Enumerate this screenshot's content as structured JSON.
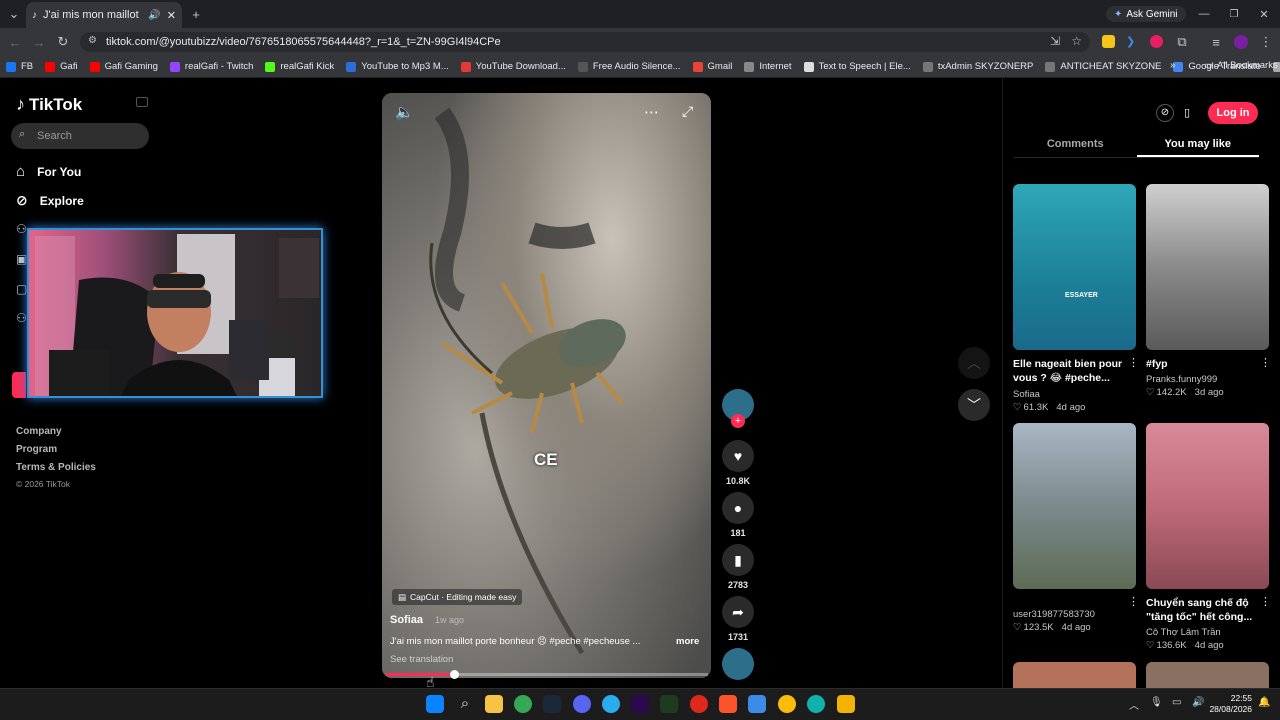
{
  "browser": {
    "tab_title": "J'ai mis mon maillot porte b",
    "url": "tiktok.com/@youtubizz/video/7676518065575644448?_r=1&_t=ZN-99GI4l94CPe",
    "ask_gemini": "Ask Gemini",
    "bookmarks": [
      {
        "label": "FB",
        "color": "#1877f2"
      },
      {
        "label": "Gafi",
        "color": "#ff0000"
      },
      {
        "label": "Gafi Gaming",
        "color": "#ff0000"
      },
      {
        "label": "realGafi - Twitch",
        "color": "#9146ff"
      },
      {
        "label": "realGafi Kick",
        "color": "#53fc18"
      },
      {
        "label": "YouTube to Mp3 M...",
        "color": "#2b6fd6"
      },
      {
        "label": "YouTube Download...",
        "color": "#e53935"
      },
      {
        "label": "Free Audio Silence...",
        "color": "#555555"
      },
      {
        "label": "Gmail",
        "color": "#ea4335"
      },
      {
        "label": "Internet",
        "color": "#888888"
      },
      {
        "label": "Text to Speech | Ele...",
        "color": "#dddddd"
      },
      {
        "label": "txAdmin SKYZONERP",
        "color": "#777777"
      },
      {
        "label": "ANTICHEAT SKYZONE",
        "color": "#777777"
      },
      {
        "label": "Google Translate",
        "color": "#4285f4"
      },
      {
        "label": "VISO",
        "color": "#aaaaaa"
      }
    ],
    "all_bookmarks": "All Bookmarks"
  },
  "sidebar": {
    "logo": "TikTok",
    "search_placeholder": "Search",
    "nav": [
      {
        "label": "For You"
      },
      {
        "label": "Explore"
      }
    ],
    "footer": [
      "Company",
      "Program",
      "Terms & Policies"
    ],
    "copyright": "© 2026 TikTok"
  },
  "video": {
    "overlay_caption": "CE",
    "capcut_label": "CapCut · Editing made easy",
    "author": "Sofiaa",
    "age": "1w ago",
    "description": "J'ai mis mon maillot porte bonheur 😣 #peche #pecheuse ...",
    "more": "more",
    "see_translation": "See translation",
    "progress_fraction": 0.21
  },
  "actions": {
    "likes": "10.8K",
    "comments": "181",
    "saves": "2783",
    "shares": "1731"
  },
  "right_panel": {
    "login": "Log in",
    "tabs": [
      "Comments",
      "You may like"
    ],
    "active_tab": 1,
    "cards": [
      {
        "title": "Elle nageait bien pour vous ? 😂 #peche...",
        "user": "Sofiaa",
        "likes": "61.3K",
        "age": "4d ago",
        "thumb_text": "ESSAYER"
      },
      {
        "title": "#fyp",
        "user": "Pranks.funny999",
        "likes": "142.2K",
        "age": "3d ago",
        "thumb_text": ""
      },
      {
        "title": "",
        "user": "user319877583730",
        "likes": "123.5K",
        "age": "4d ago",
        "thumb_text": ""
      },
      {
        "title": "Chuyển sang chế độ \"tăng tốc\" hết công...",
        "user": "Cô Thợ Lâm Trần",
        "likes": "136.6K",
        "age": "4d ago",
        "thumb_text": ""
      }
    ]
  },
  "taskbar": {
    "time": "22:55",
    "date": "28/08/2026"
  }
}
